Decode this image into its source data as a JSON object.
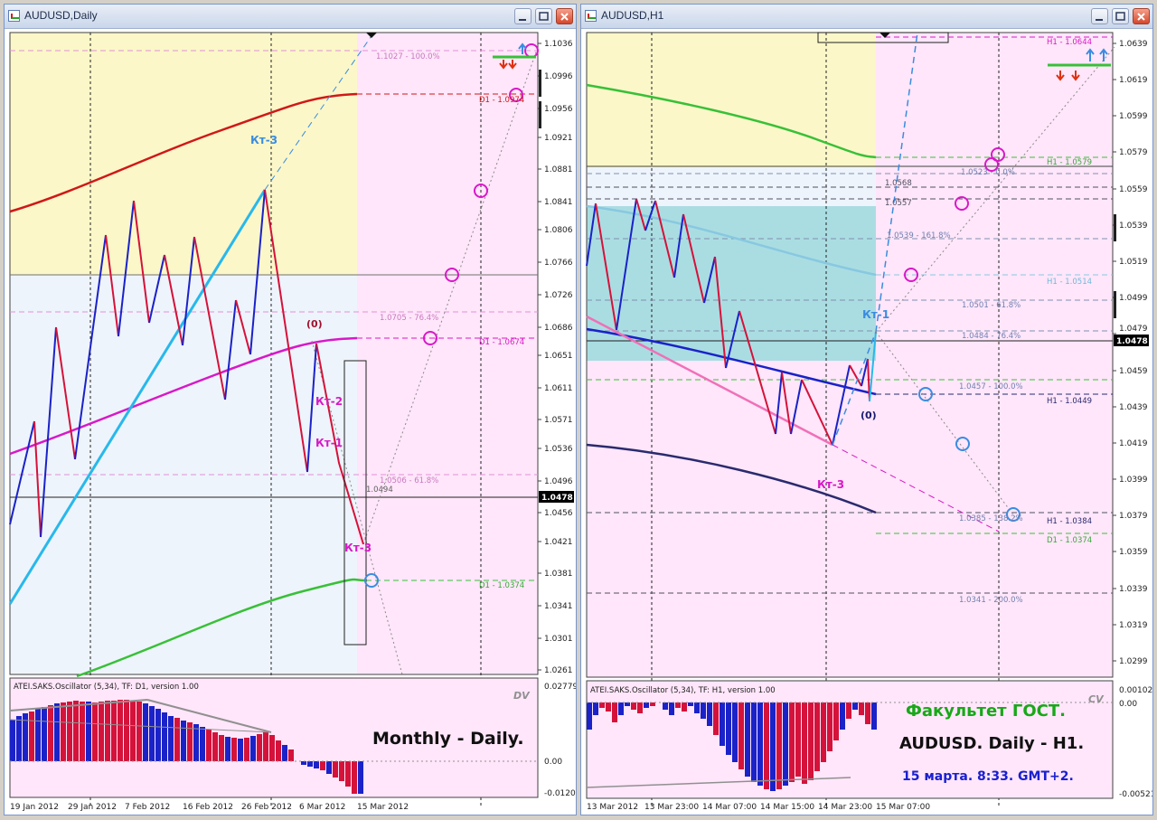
{
  "windows": [
    {
      "title": "AUDUSD,Daily",
      "price_labels": [
        "1.1036",
        "1.0996",
        "1.0956",
        "1.0921",
        "1.0881",
        "1.0841",
        "1.0806",
        "1.0766",
        "1.0726",
        "1.0686",
        "1.0651",
        "1.0611",
        "1.0571",
        "1.0536",
        "1.0496",
        "1.0456",
        "1.0421",
        "1.0381",
        "1.0341",
        "1.0301",
        "1.0261"
      ],
      "current_price": "1.0478",
      "date_labels": [
        "19 Jan 2012",
        "29 Jan 2012",
        "7 Feb 2012",
        "16 Feb 2012",
        "26 Feb 2012",
        "6 Mar 2012",
        "15 Mar 2012"
      ],
      "annotations": {
        "fib_100": "1.1027 - 100.0%",
        "d1_upper": "D1 - 1.0974",
        "fib_76": "1.0705 - 76.4%",
        "d1_mid": "D1 - 1.0674",
        "fib_61": "1.0506 - 61.8%",
        "level_1_0494": "1.0494",
        "d1_lower": "D1 - 1.0374",
        "kt3_top": "Кт-3",
        "zero": "(0)",
        "kt2": "Кт-2",
        "kt1": "Кт-1",
        "kt3_bottom": "Кт-3"
      },
      "oscillator": {
        "header": "ATEI.SAKS.Oscillator (5,34), TF: D1, version 1.00",
        "corner": "DV",
        "scale": [
          "0.02779",
          "0.00",
          "-0.01209"
        ],
        "caption": "Monthly - Daily."
      }
    },
    {
      "title": "AUDUSD,H1",
      "price_labels": [
        "1.0639",
        "1.0619",
        "1.0599",
        "1.0579",
        "1.0559",
        "1.0539",
        "1.0519",
        "1.0499",
        "1.0479",
        "1.0459",
        "1.0439",
        "1.0419",
        "1.0399",
        "1.0379",
        "1.0359",
        "1.0339",
        "1.0319",
        "1.0299"
      ],
      "current_price": "1.0478",
      "date_labels": [
        "13 Mar 2012",
        "13 Mar 23:00",
        "14 Mar 07:00",
        "14 Mar 15:00",
        "14 Mar 23:00",
        "15 Mar 07:00"
      ],
      "annotations": {
        "h1_1_0644": "H1 - 1.0644",
        "h1_1_0579": "H1 - 1.0579",
        "fib_1_0523": "1.0523 - 0.0%",
        "lvl_1_0568": "1.0568",
        "lvl_1_0557": "1.0557",
        "fib_161": "1.0539 - 161.8%",
        "h1_1_0514": "H1 - 1.0514",
        "fib_61": "1.0501 - 61.8%",
        "kt1": "Кт-1",
        "fib_76": "1.0484 - 76.4%",
        "fib_100": "1.0457 - 100.0%",
        "h1_1_0449": "H1 - 1.0449",
        "zero": "(0)",
        "kt3": "Кт-3",
        "fib_1_0385": "1.0385 - 138.2%",
        "h1_1_0384": "H1 - 1.0384",
        "d1_1_0374": "D1 - 1.0374",
        "fib_200": "1.0341 - 200.0%"
      },
      "oscillator": {
        "header": "ATEI.SAKS.Oscillator (5,34), TF: H1, version 1.00",
        "corner": "CV",
        "scale": [
          "0.00102",
          "0.00",
          "-0.00521"
        ],
        "caption_title": "Факультет ГОСТ.",
        "caption_pair": "AUDUSD. Daily - H1.",
        "caption_date": "15 марта. 8:33. GMT+2."
      }
    }
  ],
  "colors": {
    "zone_yellow": "#fbf7c8",
    "zone_pink": "#ffe6fa",
    "zone_lightblue": "#eef4fb",
    "zone_teal": "#aadde2",
    "bull": "#1a22c8",
    "bear": "#d4123a",
    "ma_red": "#d01818",
    "ma_magenta": "#d818c8",
    "ma_green": "#38c038",
    "ma_navy": "#2a2a6e",
    "trend_cyan": "#28b8ec",
    "caption_green": "#18a818",
    "caption_blue": "#1a20d0"
  }
}
